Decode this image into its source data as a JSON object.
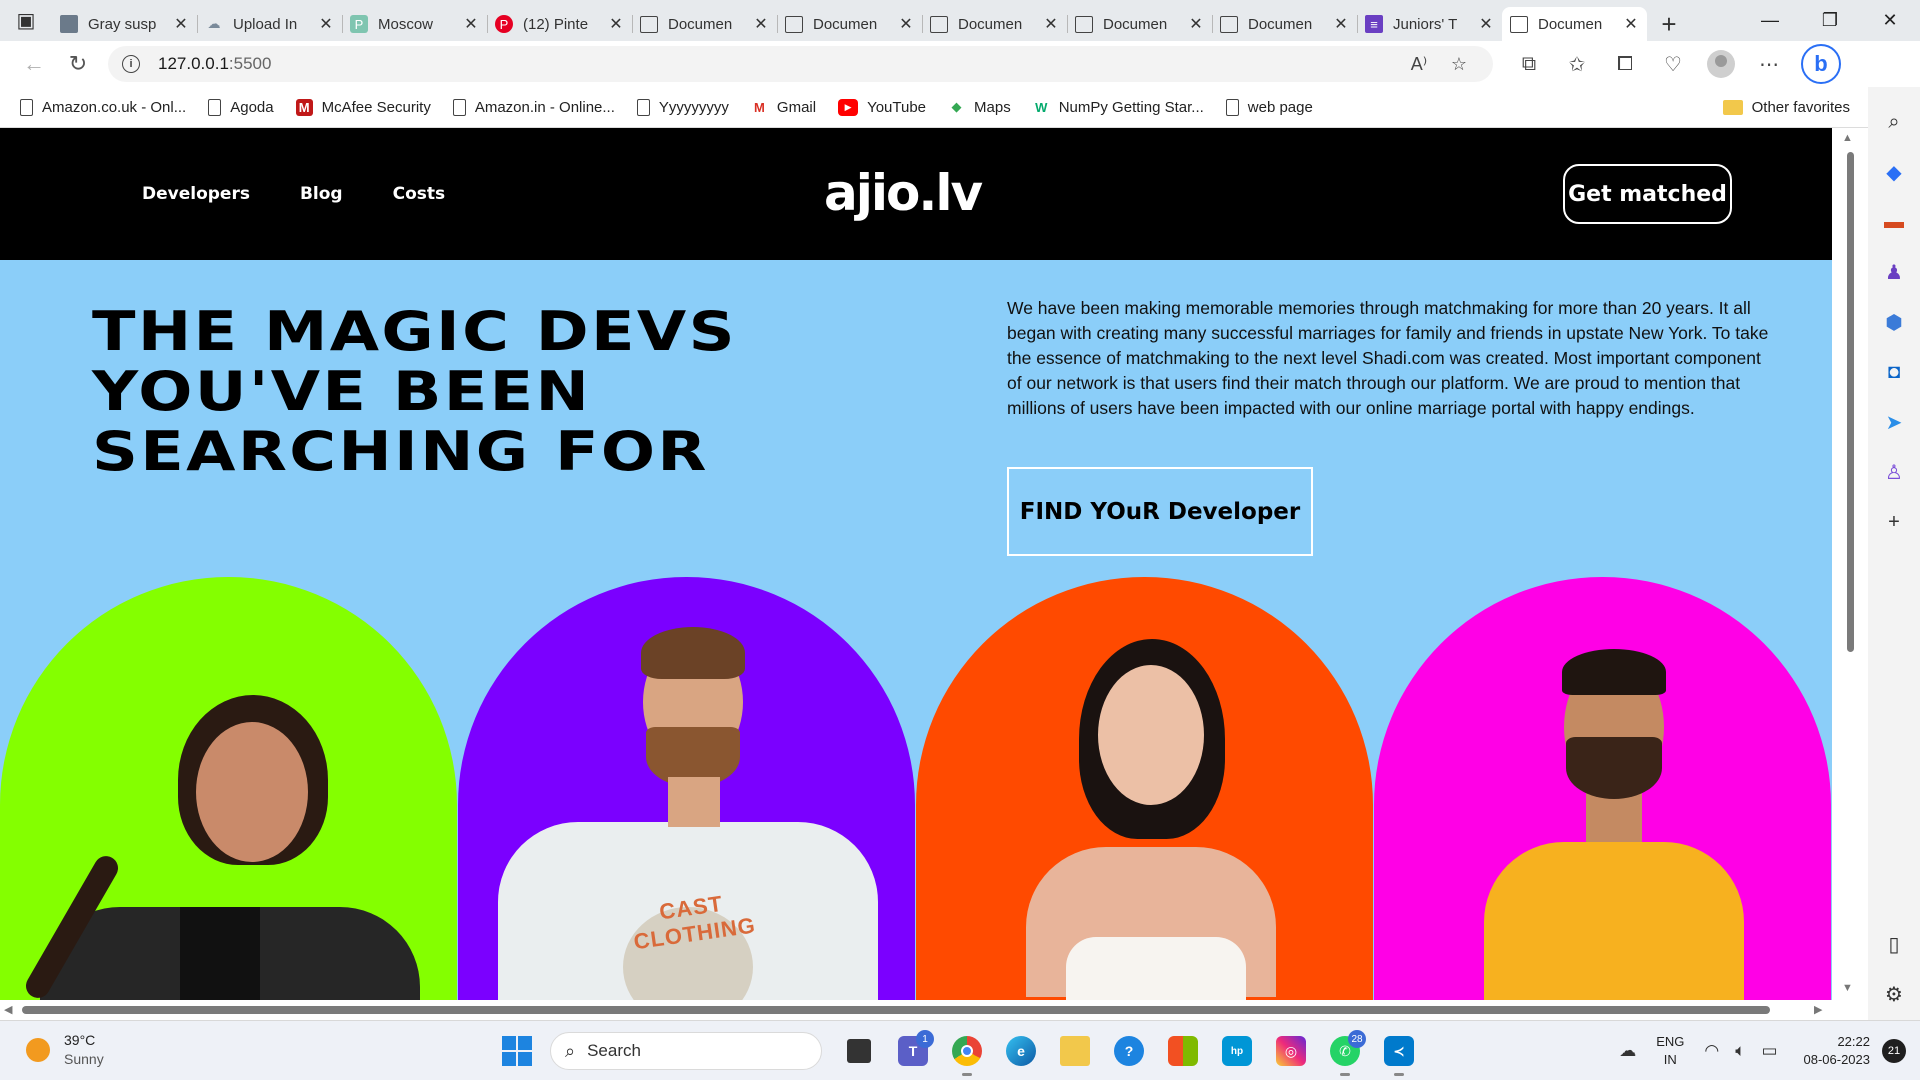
{
  "browser": {
    "tabs": [
      {
        "title": "Gray susp",
        "icon": "image-tab-icon"
      },
      {
        "title": "Upload In",
        "icon": "cloud-tab-icon"
      },
      {
        "title": "Moscow",
        "icon": "p-tab-icon"
      },
      {
        "title": "(12) Pinte",
        "icon": "pinterest-tab-icon"
      },
      {
        "title": "Documen",
        "icon": "document-tab-icon"
      },
      {
        "title": "Documen",
        "icon": "document-tab-icon"
      },
      {
        "title": "Documen",
        "icon": "document-tab-icon"
      },
      {
        "title": "Documen",
        "icon": "document-tab-icon"
      },
      {
        "title": "Documen",
        "icon": "document-tab-icon"
      },
      {
        "title": "Juniors' T",
        "icon": "form-tab-icon"
      },
      {
        "title": "Documen",
        "icon": "document-tab-icon",
        "active": true
      }
    ],
    "url_host": "127.0.0.1",
    "url_port": ":5500",
    "bookmarks": [
      {
        "label": "Amazon.co.uk - Onl...",
        "icon": "document-icon"
      },
      {
        "label": "Agoda",
        "icon": "document-icon"
      },
      {
        "label": "McAfee Security",
        "icon": "mcafee-icon"
      },
      {
        "label": "Amazon.in - Online...",
        "icon": "document-icon"
      },
      {
        "label": "Yyyyyyyyy",
        "icon": "document-icon"
      },
      {
        "label": "Gmail",
        "icon": "gmail-icon"
      },
      {
        "label": "YouTube",
        "icon": "youtube-icon"
      },
      {
        "label": "Maps",
        "icon": "maps-icon"
      },
      {
        "label": "NumPy Getting Star...",
        "icon": "w3schools-icon"
      },
      {
        "label": "web page",
        "icon": "document-icon"
      }
    ],
    "other_favorites": "Other favorites"
  },
  "site": {
    "nav": [
      "Developers",
      "Blog",
      "Costs"
    ],
    "logo": "ajio.lv",
    "cta": "Get matched",
    "hero_title": "THE MAGIC DEVS\nYOU'VE BEEN\nSEARCHING FOR",
    "hero_text": "We have been making memorable memories through matchmaking for more than 20 years. It all began with creating many successful marriages for family and friends in upstate New York. To take the essence of matchmaking to the next level Shadi.com was created. Most important component of our network is that users find their match through our platform. We are proud to mention that millions of users have been impacted with our online marriage portal with happy endings.",
    "find_button": "FIND YOuR Developer",
    "arch_colors": [
      "#84ff00",
      "#7b00ff",
      "#ff4a00",
      "#ff00e6"
    ],
    "shirt_text": "CAST CLOTHING"
  },
  "taskbar": {
    "temperature": "39°C",
    "condition": "Sunny",
    "search": "Search",
    "teams_badge": "1",
    "whatsapp_badge": "28",
    "lang_top": "ENG",
    "lang_bottom": "IN",
    "time": "22:22",
    "date": "08-06-2023",
    "notifications": "21"
  }
}
